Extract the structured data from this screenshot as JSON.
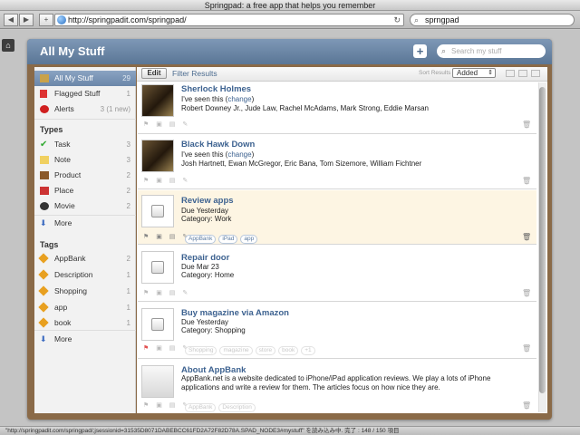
{
  "browser": {
    "title": "Springpad: a free app that helps you remember",
    "url": "http://springpadit.com/springpad/",
    "search_query": "sprngpad",
    "status": "\"http://springpadit.com/springpad/;jsessionid=31535D8071DABEBCC61FD2A72F82D78A.SPAD_NODE3#mystuff\" を読み込み中. 完了 : 148 / 150 項目"
  },
  "app": {
    "title": "All My Stuff",
    "search_placeholder": "Search my stuff"
  },
  "sidebar": {
    "main": [
      {
        "label": "All My Stuff",
        "count": "29"
      },
      {
        "label": "Flagged Stuff",
        "count": "1"
      },
      {
        "label": "Alerts",
        "count": "3 (1 new)"
      }
    ],
    "types_heading": "Types",
    "types": [
      {
        "label": "Task",
        "count": "3"
      },
      {
        "label": "Note",
        "count": "3"
      },
      {
        "label": "Product",
        "count": "2"
      },
      {
        "label": "Place",
        "count": "2"
      },
      {
        "label": "Movie",
        "count": "2"
      },
      {
        "label": "More",
        "count": ""
      }
    ],
    "tags_heading": "Tags",
    "tags": [
      {
        "label": "AppBank",
        "count": "2"
      },
      {
        "label": "Description",
        "count": "1"
      },
      {
        "label": "Shopping",
        "count": "1"
      },
      {
        "label": "app",
        "count": "1"
      },
      {
        "label": "book",
        "count": "1"
      },
      {
        "label": "More",
        "count": ""
      }
    ]
  },
  "toolbar": {
    "edit_label": "Edit",
    "filter_label": "Filter Results",
    "sort_label": "Sort Results",
    "sort_value": "Added"
  },
  "items": [
    {
      "title": "Sherlock Holmes",
      "line1_pre": "I've seen this (",
      "line1_link": "change",
      "line1_post": ")",
      "line2": "Robert Downey Jr., Jude Law, Rachel McAdams, Mark Strong, Eddie Marsan"
    },
    {
      "title": "Black Hawk Down",
      "line1_pre": "I've seen this (",
      "line1_link": "change",
      "line1_post": ")",
      "line2": "Josh Hartnett, Ewan McGregor, Eric Bana, Tom Sizemore, William Fichtner"
    },
    {
      "title": "Review apps",
      "line1": "Due Yesterday",
      "line2": "Category: Work",
      "tags": [
        "AppBank",
        "iPad",
        "app"
      ]
    },
    {
      "title": "Repair door",
      "line1": "Due Mar 23",
      "line2": "Category: Home"
    },
    {
      "title": "Buy magazine via Amazon",
      "line1": "Due Yesterday",
      "line2": "Category: Shopping",
      "tags": [
        "Shopping",
        "magazine",
        "store",
        "book",
        "+1"
      ]
    },
    {
      "title": "About AppBank",
      "description": "AppBank.net is a website dedicated to iPhone/iPad application reviews. We play a lots of iPhone applications and write a review for them. The articles focus on how nice they are.",
      "tags": [
        "AppBank",
        "Description"
      ]
    }
  ],
  "colors": {
    "header": "#5a7696",
    "link": "#3d6290",
    "highlight": "#fdf5e3",
    "frame": "#8a6a48"
  }
}
